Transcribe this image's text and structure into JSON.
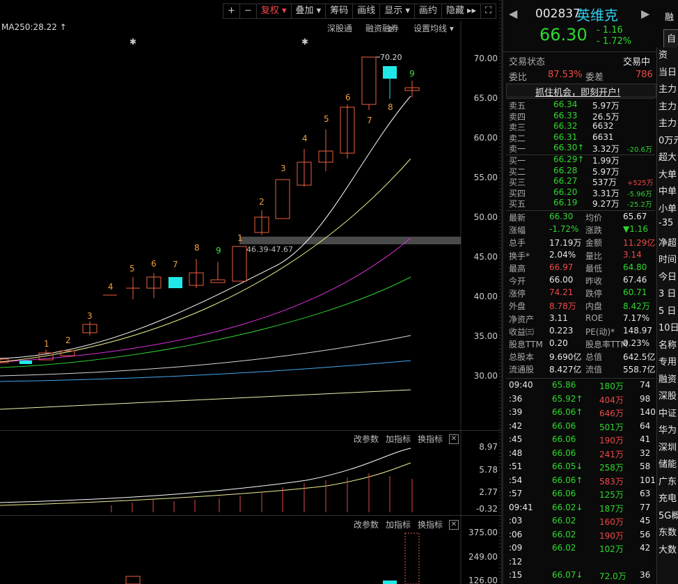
{
  "toolbar": {
    "plus": "+",
    "minus": "−",
    "fuquan": "复权",
    "diejia": "叠加",
    "chouma": "筹码",
    "huaxian": "画线",
    "xianshi": "显示",
    "huayue": "画约",
    "yincang": "隐藏 ▸▸"
  },
  "ma_label": "MA250:28.22",
  "links": {
    "shengu": "深股通",
    "rongzi": "融资融券",
    "setma": "设置均线"
  },
  "price_axis": [
    "70.00",
    "65.00",
    "60.00",
    "55.00",
    "50.00",
    "45.00",
    "40.00",
    "35.00",
    "30.00"
  ],
  "annotations": {
    "high": "70.20",
    "range": "46.39-47.67"
  },
  "candle_numbers": [
    "1",
    "2",
    "3",
    "4",
    "5",
    "6",
    "7",
    "8",
    "9",
    "1",
    "2",
    "3",
    "4",
    "5",
    "6",
    "7",
    "8",
    "9"
  ],
  "sub1": {
    "params": "改参数",
    "add": "加指标",
    "switch": "换指标",
    "axis": [
      "8.97",
      "5.78",
      "2.77",
      "-0.32"
    ]
  },
  "sub2": {
    "params": "改参数",
    "add": "加指标",
    "switch": "换指标",
    "axis": [
      "375.00",
      "249.00",
      "126.00"
    ]
  },
  "stock": {
    "code": "002837",
    "name": "英维克",
    "price": "66.30",
    "change": "- 1.16",
    "pct": "- 1.72%",
    "rong": "融",
    "zixuan": "自选"
  },
  "status": {
    "label": "交易状态",
    "value": "交易中",
    "weibi_label": "委比",
    "weibi": "87.53%",
    "weicha_label": "委差",
    "weicha": "786",
    "banner": "抓住机会，即刻开户!"
  },
  "asks": [
    {
      "label": "卖五",
      "price": "66.34",
      "vol": "5.97万",
      "chg": ""
    },
    {
      "label": "卖四",
      "price": "66.33",
      "vol": "26.5万",
      "chg": ""
    },
    {
      "label": "卖三",
      "price": "66.32",
      "vol": "6632",
      "chg": ""
    },
    {
      "label": "卖二",
      "price": "66.31",
      "vol": "6631",
      "chg": ""
    },
    {
      "label": "卖一",
      "price": "66.30↑",
      "vol": "3.32万",
      "chg": "-20.6万"
    }
  ],
  "bids": [
    {
      "label": "买一",
      "price": "66.29↑",
      "vol": "1.99万",
      "chg": ""
    },
    {
      "label": "买二",
      "price": "66.28",
      "vol": "5.97万",
      "chg": ""
    },
    {
      "label": "买三",
      "price": "66.27",
      "vol": "537万",
      "chg": "+525万"
    },
    {
      "label": "买四",
      "price": "66.20",
      "vol": "3.31万",
      "chg": "-5.96万"
    },
    {
      "label": "买五",
      "price": "66.19",
      "vol": "9.27万",
      "chg": "-25.2万"
    }
  ],
  "stats": [
    {
      "l1": "最新",
      "v1": "66.30",
      "l2": "均价",
      "v2": "65.67"
    },
    {
      "l1": "涨幅",
      "v1": "-1.72%",
      "l2": "涨跌",
      "v2": "▼1.16"
    },
    {
      "l1": "总手",
      "v1": "17.19万",
      "l2": "金额",
      "v2": "11.29亿"
    },
    {
      "l1": "换手*",
      "v1": "2.04%",
      "l2": "量比",
      "v2": "3.14"
    },
    {
      "l1": "最高",
      "v1": "66.97",
      "l2": "最低",
      "v2": "64.80"
    },
    {
      "l1": "今开",
      "v1": "66.00",
      "l2": "昨收",
      "v2": "67.46"
    },
    {
      "l1": "涨停",
      "v1": "74.21",
      "l2": "跌停",
      "v2": "60.71"
    },
    {
      "l1": "外盘",
      "v1": "8.78万",
      "l2": "内盘",
      "v2": "8.42万"
    },
    {
      "l1": "净资产",
      "v1": "3.11",
      "l2": "ROE",
      "v2": "7.17%"
    },
    {
      "l1": "收益㈢",
      "v1": "0.223",
      "l2": "PE(动)*",
      "v2": "148.97"
    },
    {
      "l1": "股息TTM",
      "v1": "0.20",
      "l2": "股息率TTM",
      "v2": "0.23%"
    },
    {
      "l1": "总股本",
      "v1": "9.690亿",
      "l2": "总值",
      "v2": "642.5亿"
    },
    {
      "l1": "流通股",
      "v1": "8.427亿",
      "l2": "流值",
      "v2": "558.7亿"
    }
  ],
  "ticks": [
    {
      "t": "09:40",
      "p": "65.86",
      "v": "180万",
      "n": "74"
    },
    {
      "t": ":36",
      "p": "65.92↑",
      "v": "404万",
      "n": "98"
    },
    {
      "t": ":39",
      "p": "66.06↑",
      "v": "646万",
      "n": "140"
    },
    {
      "t": ":42",
      "p": "66.06",
      "v": "501万",
      "n": "64"
    },
    {
      "t": ":45",
      "p": "66.06",
      "v": "190万",
      "n": "41"
    },
    {
      "t": ":48",
      "p": "66.06",
      "v": "241万",
      "n": "32"
    },
    {
      "t": ":51",
      "p": "66.05↓",
      "v": "258万",
      "n": "58"
    },
    {
      "t": ":54",
      "p": "66.06↑",
      "v": "583万",
      "n": "101"
    },
    {
      "t": ":57",
      "p": "66.06",
      "v": "125万",
      "n": "63"
    },
    {
      "t": "09:41",
      "p": "66.02↓",
      "v": "187万",
      "n": "77"
    },
    {
      "t": ":03",
      "p": "66.02",
      "v": "160万",
      "n": "45"
    },
    {
      "t": ":06",
      "p": "66.02",
      "v": "190万",
      "n": "56"
    },
    {
      "t": ":09",
      "p": "66.02",
      "v": "102万",
      "n": "42"
    },
    {
      "t": ":12",
      "p": "",
      "v": "",
      "n": ""
    },
    {
      "t": ":15",
      "p": "66.07↓",
      "v": "72.0万",
      "n": "36"
    }
  ],
  "side_cut": [
    "资",
    "当日",
    "主力",
    "主力",
    "主力",
    "0万元",
    "超大",
    "大单",
    "中单",
    "小单",
    "-35",
    "净超",
    "时间",
    "今日",
    "3 日",
    "5 日",
    "10日",
    "名称",
    "专用",
    "融资",
    "深股",
    "中证",
    "华为",
    "深圳",
    "储能",
    "广东",
    "充电",
    "5G概",
    "东数",
    "大数"
  ]
}
